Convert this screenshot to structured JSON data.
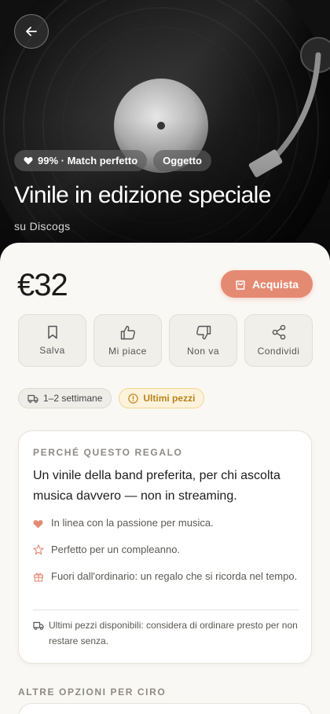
{
  "hero": {
    "back_icon": "arrow-left-icon",
    "match_chip": "99% · Match perfetto",
    "type_chip": "Oggetto",
    "title": "Vinile in edizione speciale",
    "source": "su Discogs"
  },
  "product": {
    "price": "€32",
    "buy_label": "Acquista",
    "accent_color": "#e58a72"
  },
  "actions": [
    {
      "label": "Salva",
      "icon": "bookmark-icon"
    },
    {
      "label": "Mi piace",
      "icon": "thumbs-up-icon"
    },
    {
      "label": "Non va",
      "icon": "thumbs-down-icon"
    },
    {
      "label": "Condividi",
      "icon": "share-icon"
    }
  ],
  "tags": {
    "shipping": "1–2 settimane",
    "stock": "Ultimi pezzi"
  },
  "reason_card": {
    "kicker": "PERCHÉ QUESTO REGALO",
    "lead": "Un vinile della band preferita, per chi ascolta musica davvero — non in streaming.",
    "reasons": [
      {
        "icon": "heart-icon",
        "text": "In linea con la passione per musica."
      },
      {
        "icon": "star-icon",
        "text": "Perfetto per un compleanno."
      },
      {
        "icon": "gift-icon",
        "text": "Fuori dall'ordinario: un regalo che si ricorda nel tempo."
      }
    ],
    "note": "Ultimi pezzi disponibili: considera di ordinare presto per non restare senza."
  },
  "more": {
    "title": "ALTRE OPZIONI PER CIRO"
  }
}
